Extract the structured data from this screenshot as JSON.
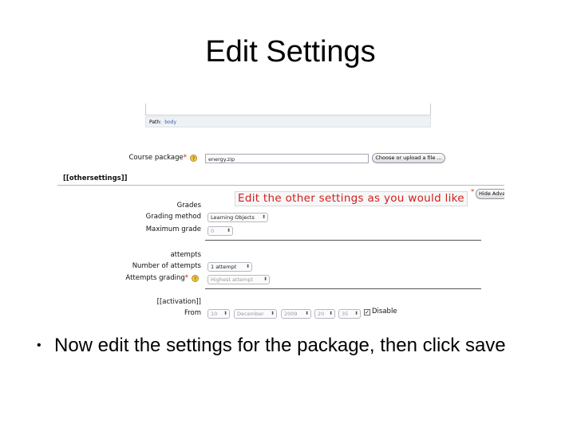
{
  "slide": {
    "title": "Edit Settings",
    "bullet": "Now edit the settings for the package, then click save"
  },
  "screenshot": {
    "path_label": "Path:",
    "path_value": "body",
    "course_package_label": "Course package",
    "course_package_value": "energy.zip",
    "choose_button": "Choose or upload a file ...",
    "section_header": "[[othersettings]]",
    "annotation": "Edit the other settings as you would like",
    "hide_advanced": "Hide Advanced",
    "grades_label": "Grades",
    "grading_method_label": "Grading method",
    "grading_method_value": "Learning Objects",
    "maximum_grade_label": "Maximum grade",
    "maximum_grade_value": "0",
    "attempts_label": "attempts",
    "number_of_attempts_label": "Number of attempts",
    "number_of_attempts_value": "1 attempt",
    "attempts_grading_label": "Attempts grading",
    "attempts_grading_value": "Highest attempt",
    "activation_label": "[[activation]]",
    "from_label": "From",
    "from_day": "10",
    "from_month": "December",
    "from_year": "2009",
    "from_hour": "20",
    "from_minute": "35",
    "disable_label": "Disable",
    "disable_checked": true,
    "required_mark": "*",
    "help_glyph": "?",
    "select_arrow": "⬍",
    "check_mark": "✓"
  },
  "colors": {
    "annotation": "#d31d1d",
    "required": "#cc2200",
    "help_icon": "#f2c84b"
  }
}
